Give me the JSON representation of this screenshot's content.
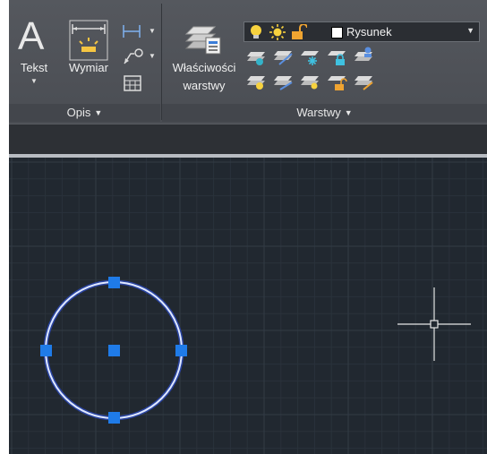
{
  "ribbon": {
    "annotation_panel": {
      "title": "Opis",
      "text_button": "Tekst",
      "dimension_button": "Wymiar"
    },
    "layers_panel": {
      "title": "Warstwy",
      "properties_button_line1": "Właściwości",
      "properties_button_line2": "warstwy",
      "current_layer": "Rysunek"
    }
  },
  "colors": {
    "ribbon_bg": "#4a4d53",
    "canvas_bg": "#212830",
    "grip": "#1f7be8",
    "circle": "#c9d9ff"
  }
}
